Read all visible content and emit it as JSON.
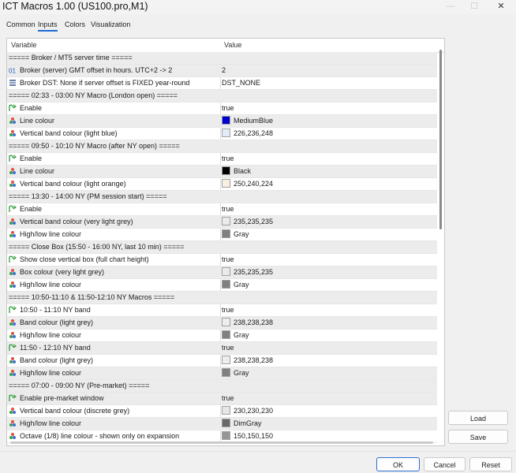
{
  "window": {
    "title": "ICT Macros 1.00 (US100.pro,M1)",
    "minimize_glyph": "—",
    "maximize_glyph": "☐",
    "close_glyph": "✕"
  },
  "tabs": [
    {
      "label": "Common"
    },
    {
      "label": "Inputs"
    },
    {
      "label": "Colors"
    },
    {
      "label": "Visualization"
    }
  ],
  "grid": {
    "header_variable": "Variable",
    "header_value": "Value",
    "rows": [
      {
        "type": "section",
        "variable": "===== Broker / MT5 server time =====",
        "value": ""
      },
      {
        "type": "int",
        "variable": "Broker (server) GMT offset in hours. UTC+2 -> 2",
        "value": "2"
      },
      {
        "type": "enum",
        "variable": "Broker DST: None if server offset is FIXED year-round",
        "value": "DST_NONE"
      },
      {
        "type": "section",
        "variable": "===== 02:33 - 03:00 NY Macro (London open) =====",
        "value": ""
      },
      {
        "type": "bool",
        "variable": "Enable",
        "value": "true"
      },
      {
        "type": "color",
        "variable": "Line colour",
        "value": "MediumBlue",
        "swatch": "#0000cd"
      },
      {
        "type": "color",
        "variable": "Vertical band colour (light blue)",
        "value": "226,236,248",
        "swatch": "#e2ecf8"
      },
      {
        "type": "section",
        "variable": "===== 09:50 - 10:10 NY Macro (after NY open) =====",
        "value": ""
      },
      {
        "type": "bool",
        "variable": "Enable",
        "value": "true"
      },
      {
        "type": "color",
        "variable": "Line colour",
        "value": "Black",
        "swatch": "#000000"
      },
      {
        "type": "color",
        "variable": "Vertical band colour (light orange)",
        "value": "250,240,224",
        "swatch": "#faf0e0"
      },
      {
        "type": "section",
        "variable": "===== 13:30 - 14:00 NY (PM session start) =====",
        "value": ""
      },
      {
        "type": "bool",
        "variable": "Enable",
        "value": "true"
      },
      {
        "type": "color",
        "variable": "Vertical band colour (very light grey)",
        "value": "235,235,235",
        "swatch": "#ebebeb"
      },
      {
        "type": "color",
        "variable": "High/low line colour",
        "value": "Gray",
        "swatch": "#808080"
      },
      {
        "type": "section",
        "variable": "===== Close Box (15:50 - 16:00 NY, last 10 min) =====",
        "value": ""
      },
      {
        "type": "bool",
        "variable": "Show close vertical box (full chart height)",
        "value": "true"
      },
      {
        "type": "color",
        "variable": "Box colour (very light grey)",
        "value": "235,235,235",
        "swatch": "#ebebeb"
      },
      {
        "type": "color",
        "variable": "High/low line colour",
        "value": "Gray",
        "swatch": "#808080"
      },
      {
        "type": "section",
        "variable": "===== 10:50-11:10 & 11:50-12:10 NY Macros =====",
        "value": ""
      },
      {
        "type": "bool",
        "variable": "10:50 - 11:10 NY band",
        "value": "true"
      },
      {
        "type": "color",
        "variable": "Band colour (light grey)",
        "value": "238,238,238",
        "swatch": "#eeeeee"
      },
      {
        "type": "color",
        "variable": "High/low line colour",
        "value": "Gray",
        "swatch": "#808080"
      },
      {
        "type": "bool",
        "variable": "11:50 - 12:10 NY band",
        "value": "true"
      },
      {
        "type": "color",
        "variable": "Band colour (light grey)",
        "value": "238,238,238",
        "swatch": "#eeeeee"
      },
      {
        "type": "color",
        "variable": "High/low line colour",
        "value": "Gray",
        "swatch": "#808080"
      },
      {
        "type": "section",
        "variable": "===== 07:00 - 09:00 NY (Pre-market) =====",
        "value": ""
      },
      {
        "type": "bool",
        "variable": "Enable pre-market window",
        "value": "true"
      },
      {
        "type": "color",
        "variable": "Vertical band colour (discrete grey)",
        "value": "230,230,230",
        "swatch": "#e6e6e6"
      },
      {
        "type": "color",
        "variable": "High/low line colour",
        "value": "DimGray",
        "swatch": "#696969"
      },
      {
        "type": "color",
        "variable": "Octave (1/8) line colour - shown only on expansion",
        "value": "150,150,150",
        "swatch": "#969696"
      }
    ]
  },
  "buttons": {
    "load": "Load",
    "save": "Save",
    "ok": "OK",
    "cancel": "Cancel",
    "reset": "Reset"
  },
  "colors": {
    "accent": "#1e6ad6",
    "bool_icon": "#2e9c3a",
    "int_icon": "#1f5fbf"
  }
}
